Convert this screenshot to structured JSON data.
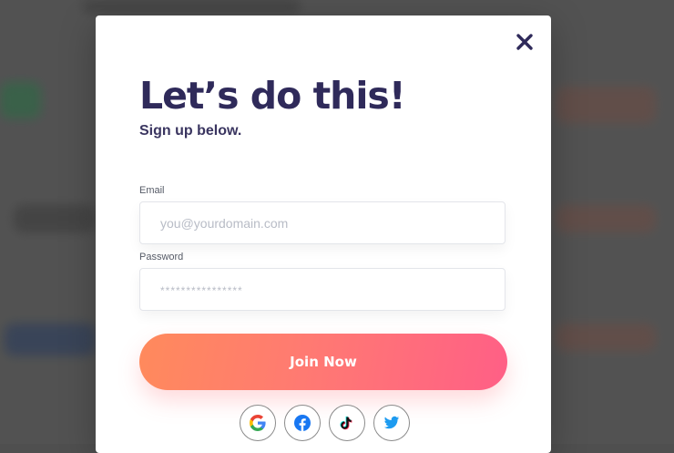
{
  "modal": {
    "title": "Let’s do this!",
    "subtitle": "Sign up below.",
    "email": {
      "label": "Email",
      "placeholder": "you@yourdomain.com",
      "value": ""
    },
    "password": {
      "label": "Password",
      "placeholder": "****************",
      "value": ""
    },
    "join_label": "Join Now",
    "socials": [
      {
        "name": "google-icon"
      },
      {
        "name": "facebook-icon"
      },
      {
        "name": "tiktok-icon"
      },
      {
        "name": "twitter-icon"
      }
    ]
  },
  "colors": {
    "title": "#2f2a5a",
    "button_start": "#ff8a5c",
    "button_end": "#ff5f86",
    "facebook": "#1877f2",
    "twitter": "#1d9bf0"
  }
}
